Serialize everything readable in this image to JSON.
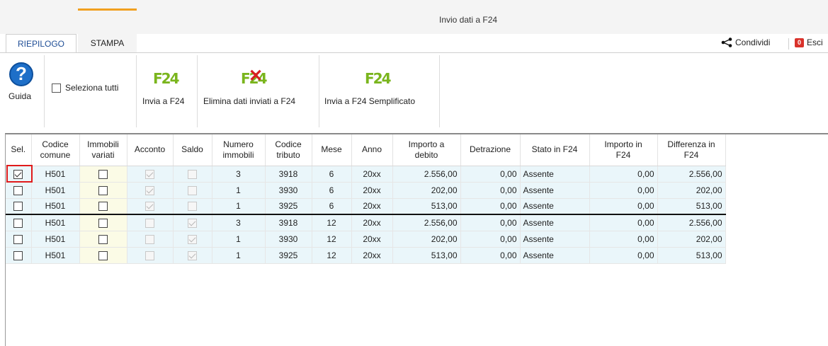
{
  "window": {
    "title": "Invio dati a F24"
  },
  "tabs": [
    {
      "label": "RIEPILOGO",
      "active": true
    },
    {
      "label": "STAMPA",
      "active": false
    }
  ],
  "top_actions": {
    "share_label": "Condividi",
    "exit_label": "Esci",
    "exit_icon_text": "0"
  },
  "ribbon": {
    "help_label": "Guida",
    "select_all_label": "Seleziona tutti",
    "send_label": "Invia a F24",
    "delete_label": "Elimina dati inviati a F24",
    "send_simple_label": "Invia a F24 Semplificato",
    "f24_icon_text": "F24"
  },
  "table": {
    "headers": {
      "sel": "Sel.",
      "codice_comune": [
        "Codice",
        "comune"
      ],
      "immobili_variati": [
        "Immobili",
        "variati"
      ],
      "acconto": "Acconto",
      "saldo": "Saldo",
      "numero_immobili": [
        "Numero",
        "immobili"
      ],
      "codice_tributo": [
        "Codice",
        "tributo"
      ],
      "mese": "Mese",
      "anno": "Anno",
      "importo_debito": [
        "Importo a",
        "debito"
      ],
      "detrazione": "Detrazione",
      "stato": "Stato in F24",
      "importo_f24": [
        "Importo in",
        "F24"
      ],
      "differenza": [
        "Differenza in",
        "F24"
      ]
    },
    "rows": [
      {
        "sel": true,
        "comune": "H501",
        "variati": false,
        "acconto": true,
        "saldo": false,
        "numero": "3",
        "tributo": "3918",
        "mese": "6",
        "anno": "20xx",
        "debito": "2.556,00",
        "detrazione": "0,00",
        "stato": "Assente",
        "importo_f24": "0,00",
        "differenza": "2.556,00"
      },
      {
        "sel": false,
        "comune": "H501",
        "variati": false,
        "acconto": true,
        "saldo": false,
        "numero": "1",
        "tributo": "3930",
        "mese": "6",
        "anno": "20xx",
        "debito": "202,00",
        "detrazione": "0,00",
        "stato": "Assente",
        "importo_f24": "0,00",
        "differenza": "202,00"
      },
      {
        "sel": false,
        "comune": "H501",
        "variati": false,
        "acconto": true,
        "saldo": false,
        "numero": "1",
        "tributo": "3925",
        "mese": "6",
        "anno": "20xx",
        "debito": "513,00",
        "detrazione": "0,00",
        "stato": "Assente",
        "importo_f24": "0,00",
        "differenza": "513,00"
      },
      {
        "sel": false,
        "comune": "H501",
        "variati": false,
        "acconto": false,
        "saldo": true,
        "numero": "3",
        "tributo": "3918",
        "mese": "12",
        "anno": "20xx",
        "debito": "2.556,00",
        "detrazione": "0,00",
        "stato": "Assente",
        "importo_f24": "0,00",
        "differenza": "2.556,00"
      },
      {
        "sel": false,
        "comune": "H501",
        "variati": false,
        "acconto": false,
        "saldo": true,
        "numero": "1",
        "tributo": "3930",
        "mese": "12",
        "anno": "20xx",
        "debito": "202,00",
        "detrazione": "0,00",
        "stato": "Assente",
        "importo_f24": "0,00",
        "differenza": "202,00"
      },
      {
        "sel": false,
        "comune": "H501",
        "variati": false,
        "acconto": false,
        "saldo": true,
        "numero": "1",
        "tributo": "3925",
        "mese": "12",
        "anno": "20xx",
        "debito": "513,00",
        "detrazione": "0,00",
        "stato": "Assente",
        "importo_f24": "0,00",
        "differenza": "513,00"
      }
    ]
  },
  "colors": {
    "accent": "#f0a020",
    "row_bg": "#eaf6fa",
    "highlight": "#e01b1b",
    "f24_green": "#7ab51d"
  }
}
